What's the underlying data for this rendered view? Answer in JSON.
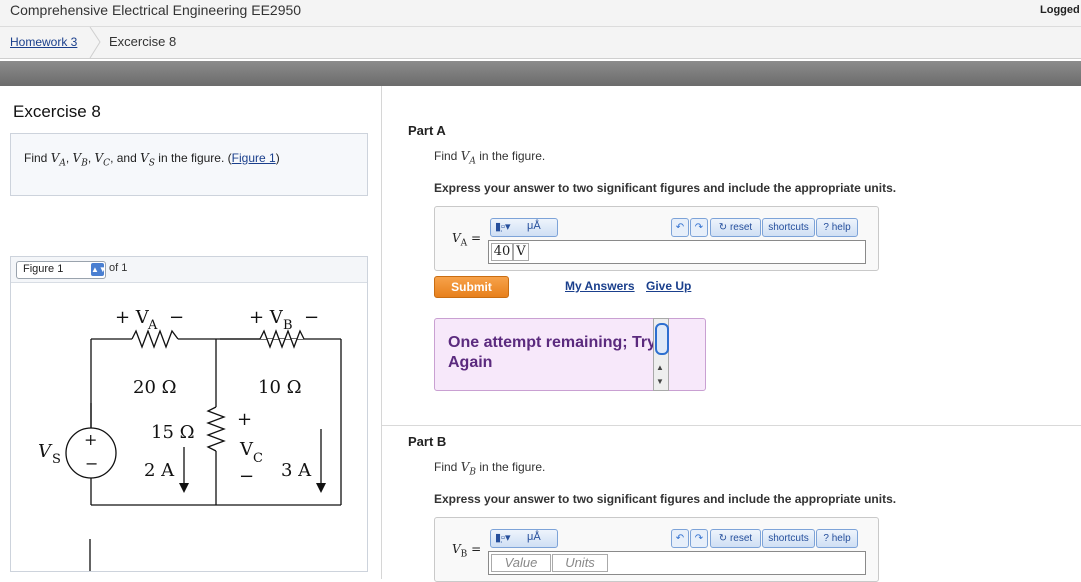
{
  "header": {
    "course_title": "Comprehensive Electrical Engineering EE2950",
    "logged": "Logged"
  },
  "breadcrumb": {
    "parent": "Homework 3",
    "current": "Excercise 8"
  },
  "left": {
    "title": "Excercise 8",
    "question": {
      "prefix": "Find ",
      "va": "VA",
      "vb": "VB",
      "vc": "VC",
      "and": ", and ",
      "vs": "VS",
      "suffix": " in the figure. (",
      "link": "Figure 1",
      "close": ")"
    },
    "figure": {
      "select_value": "Figure 1",
      "of": "of 1",
      "circuit_labels": {
        "va": "+ V",
        "va_sub": "A",
        "va_minus": "−",
        "vb": "+ V",
        "vb_sub": "B",
        "vb_minus": "−",
        "r1": "20 Ω",
        "r2": "10 Ω",
        "r3": "15 Ω",
        "vc": "V",
        "vc_sub": "C",
        "vc_plus": "+",
        "vc_minus": "−",
        "vs": "V",
        "vs_sub": "S",
        "src_plus": "+",
        "src_minus": "−",
        "i1": "2 A",
        "i2": "3 A"
      }
    }
  },
  "part_a": {
    "label": "Part A",
    "find_prefix": "Find ",
    "var": "VA",
    "find_suffix": " in the figure.",
    "express": "Express your answer to two significant figures and include the appropriate units.",
    "var_label": "VA =",
    "value": "40",
    "unit": "V",
    "submit": "Submit",
    "my_answers": "My Answers",
    "give_up": "Give Up",
    "feedback": "One attempt remaining; Try Again"
  },
  "part_b": {
    "label": "Part B",
    "find_prefix": "Find ",
    "var": "VB",
    "find_suffix": " in the figure.",
    "express": "Express your answer to two significant figures and include the appropriate units.",
    "var_label": "VB =",
    "value_placeholder": "Value",
    "unit_placeholder": "Units"
  },
  "toolbar": {
    "templates_icon": "templates-icon",
    "mu_a": "μÅ",
    "reset": "reset",
    "shortcuts": "shortcuts",
    "help": "help"
  },
  "colors": {
    "accent_link": "#1a3f8c",
    "submit": "#e7801c",
    "feedback_bg": "#f7e8fa",
    "feedback_text": "#5b2a7e"
  }
}
